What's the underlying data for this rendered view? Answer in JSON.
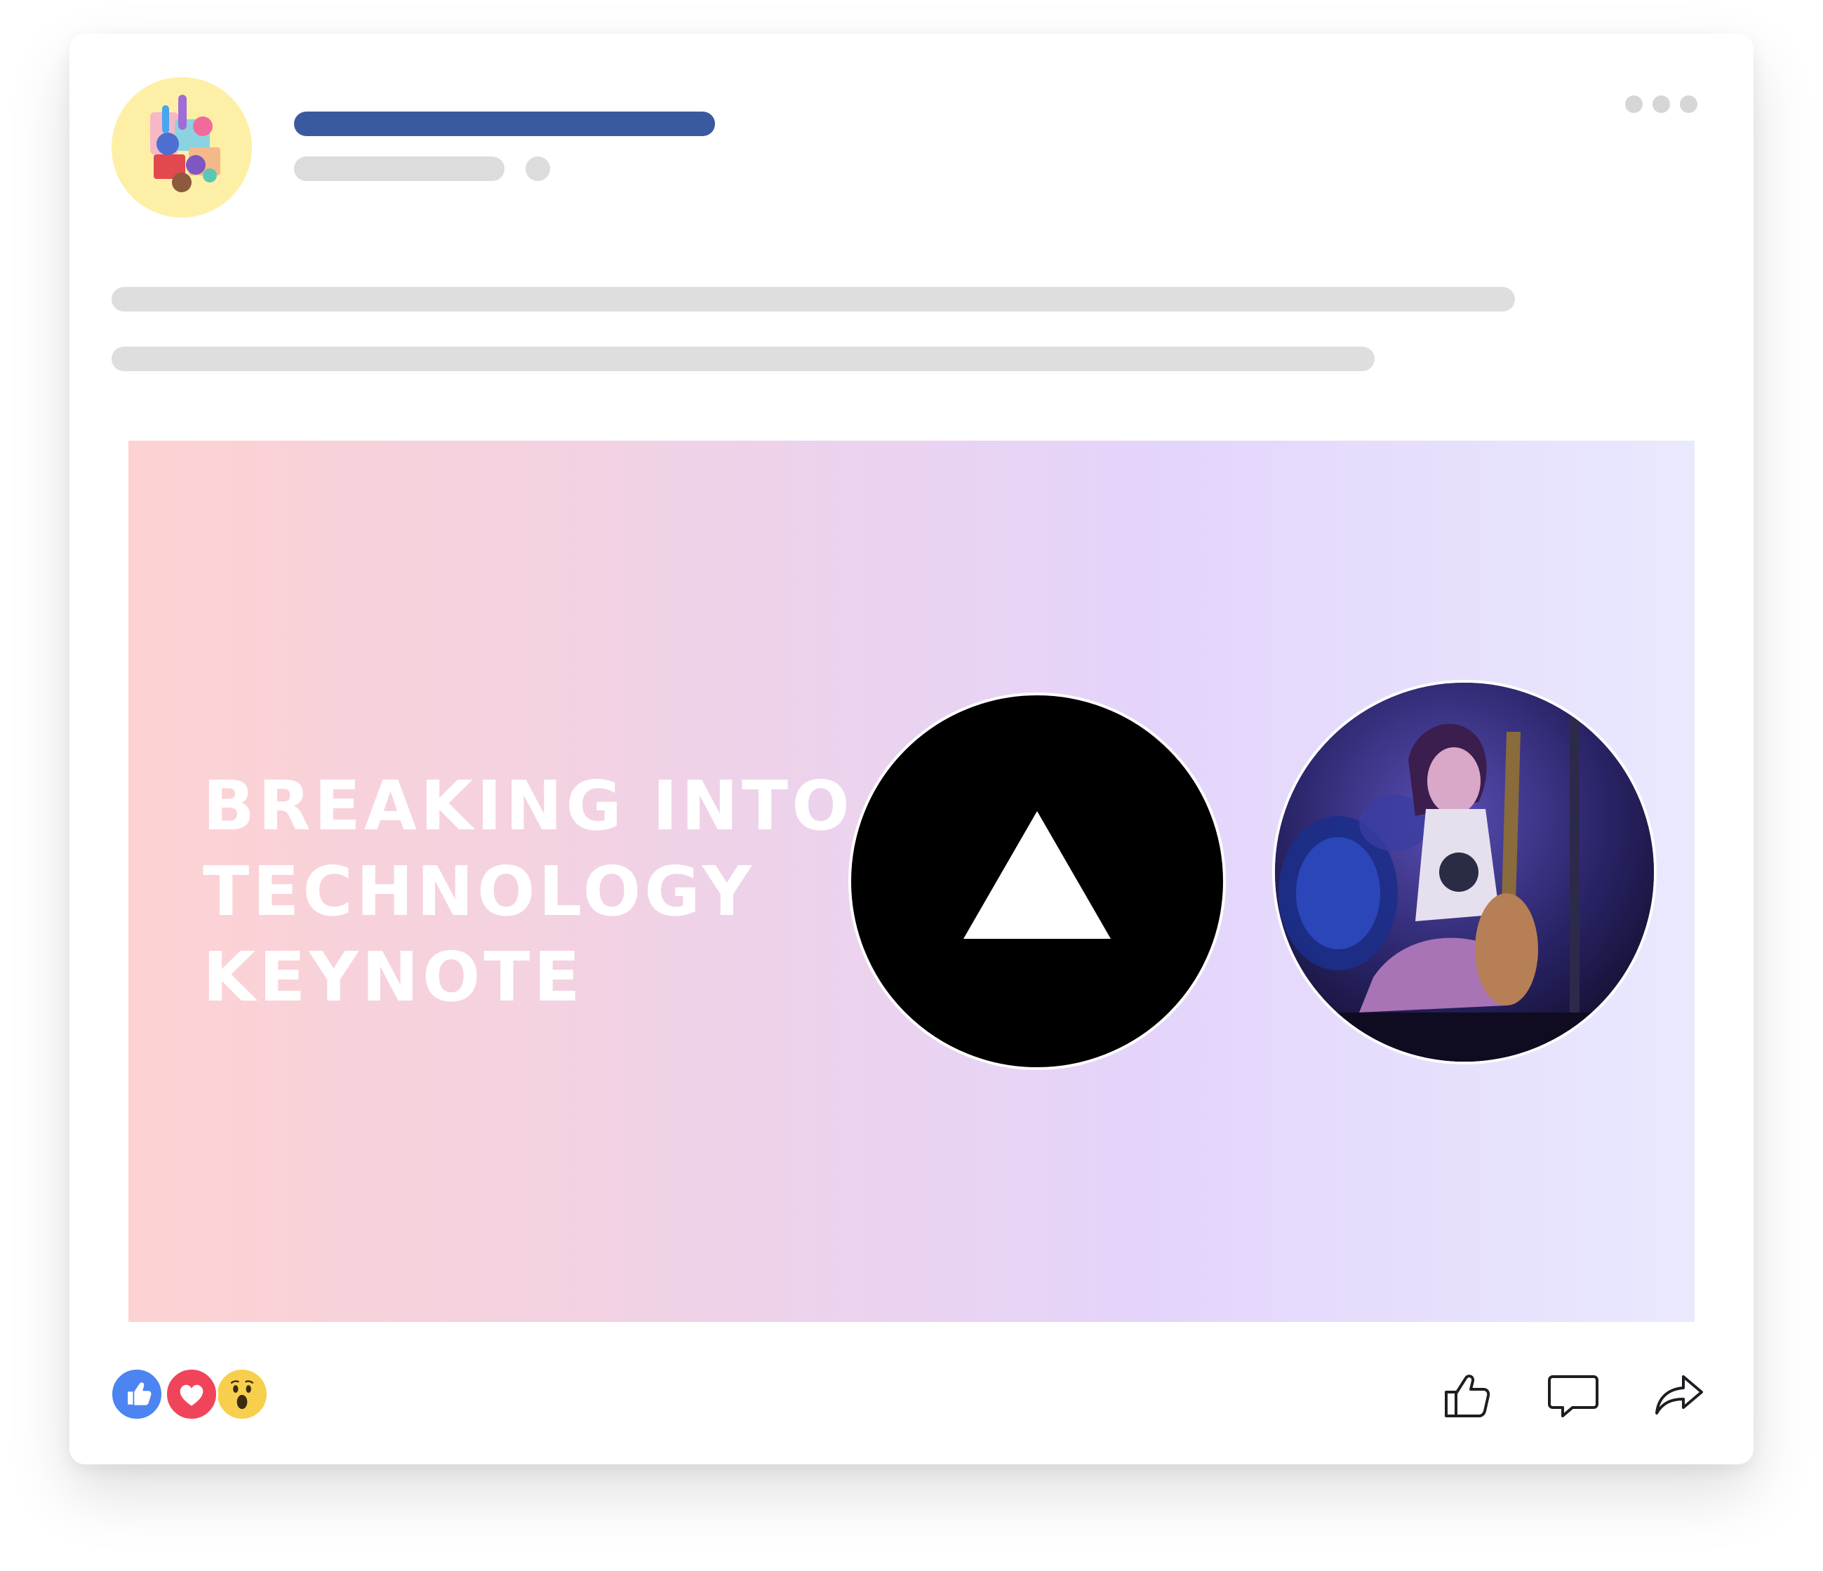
{
  "post": {
    "title_lines": [
      "BREAKING INTO",
      "TECHNOLOGY",
      "KEYNOTE"
    ]
  },
  "icons": {
    "more": "more-dots-icon",
    "reactions": [
      "like-reaction-icon",
      "love-reaction-icon",
      "wow-reaction-icon"
    ],
    "actions": [
      "like-icon",
      "comment-icon",
      "share-icon"
    ]
  },
  "colors": {
    "name_bar": "#3a5aa0",
    "placeholder": "#dcdcdc",
    "gradient_start": "#fdd2d2",
    "gradient_end": "#e9e9fe",
    "like": "#4c84f1",
    "love": "#f0445b",
    "wow": "#f8cf4d"
  }
}
